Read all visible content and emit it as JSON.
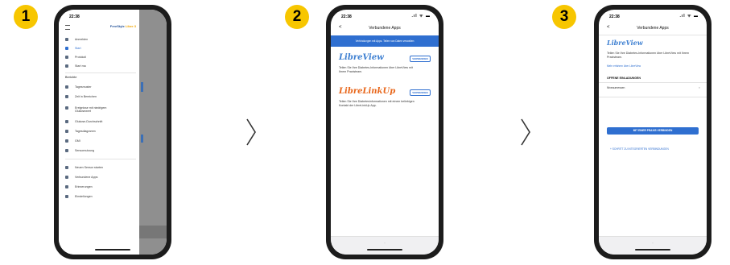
{
  "steps": [
    "1",
    "2",
    "3"
  ],
  "status_time": "22:38",
  "status_icons": ".ıl ᯤ ▬",
  "colors": {
    "badge": "#f7c600",
    "primary": "#2f6fd0",
    "brand_orange": "#f0a500"
  },
  "phone1": {
    "brand_prefix": "FreeStyle ",
    "brand_suffix": "Libre 3",
    "menu_top": [
      {
        "label": "Anmelden",
        "icon": "user-icon"
      },
      {
        "label": "Start",
        "icon": "home-icon",
        "active": true
      },
      {
        "label": "Protokoll",
        "icon": "list-icon"
      },
      {
        "label": "Start ma",
        "icon": "play-icon"
      }
    ],
    "section_label": "Berichte",
    "menu_reports": [
      {
        "label": "Tagesmuster",
        "icon": "chart-icon"
      },
      {
        "label": "Zeit in Bereichen",
        "icon": "chart-icon"
      },
      {
        "label": "Ereignisse mit niedrigem Glukosewert",
        "icon": "chart-icon"
      },
      {
        "label": "Glukose-Durchschnitt",
        "icon": "chart-icon"
      },
      {
        "label": "Tagesdiagramm",
        "icon": "chart-icon"
      },
      {
        "label": "GMI",
        "icon": "chart-icon"
      },
      {
        "label": "Sensornutzung",
        "icon": "chart-icon"
      }
    ],
    "menu_bottom": [
      {
        "label": "Neuen Sensor starten",
        "icon": "sensor-icon"
      },
      {
        "label": "Verbundene Apps",
        "icon": "link-icon"
      },
      {
        "label": "Erinnerungen",
        "icon": "bell-icon"
      },
      {
        "label": "Einstellungen",
        "icon": "gear-icon"
      }
    ]
  },
  "phone2": {
    "title": "Verbundene Apps",
    "back": "<",
    "banner": "Verbindungen mit Apps. Teilen von Daten verwalten",
    "apps": [
      {
        "logo": "LibreView",
        "button": "VERWENDEN",
        "description": "Teilen Sie Ihre Diabetes-Informationen über LibreView mit Ihrem Praxisteam."
      },
      {
        "logo": "LibreLinkUp",
        "button": "VERWENDEN",
        "description": "Teilen Sie Ihre Diabetesinformationen mit einem beliebigen Kontakt der LibreLinkUp App."
      }
    ]
  },
  "phone3": {
    "title": "Verbundene Apps",
    "back": "<",
    "logo": "LibreView",
    "description": "Teilen Sie Ihre Diabetes-Informationen über LibreView mit Ihrem Praxisteam.",
    "link": "Mehr erfahren über LibreView",
    "section": "OFFENE EINLADUNGEN",
    "invite_item": "Niveaumessen",
    "primary_button": "MIT EINER PRAXIS VERBINDEN",
    "secondary": "+ SCHRITT ZU INTEGRIERTEN VERBINDUNGEN"
  }
}
